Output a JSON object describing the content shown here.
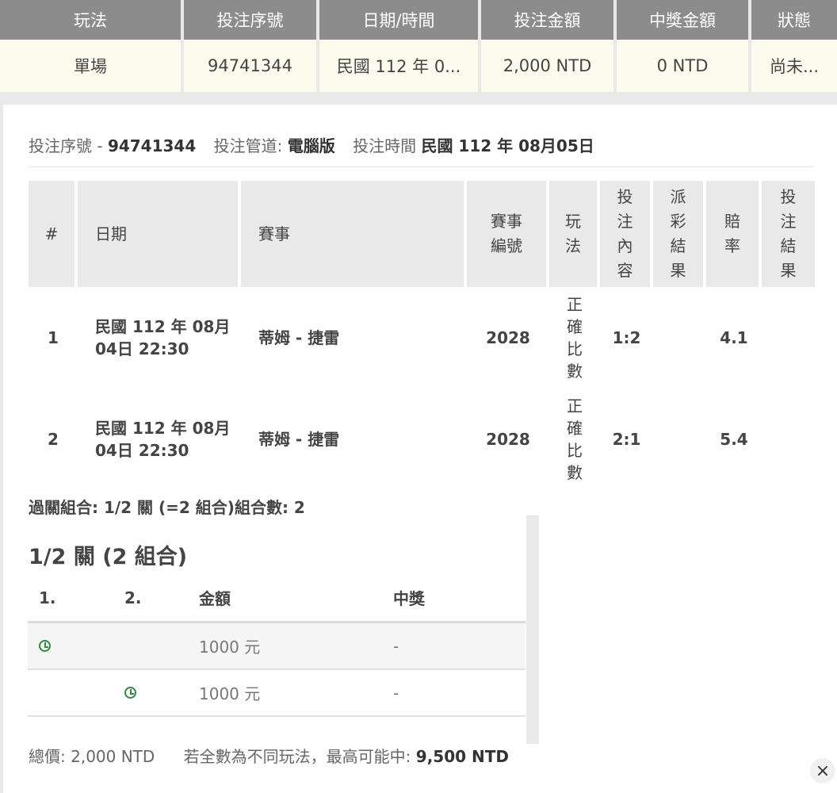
{
  "summary": {
    "headers": [
      "玩法",
      "投注序號",
      "日期/時間",
      "投注金額",
      "中獎金額",
      "狀態"
    ],
    "row": [
      "單場",
      "94741344",
      "民國 112 年 0...",
      "2,000 NTD",
      "0 NTD",
      "尚未..."
    ]
  },
  "info": {
    "serial_label": "投注序號 -",
    "serial": "94741344",
    "channel_label": "投注管道:",
    "channel": "電腦版",
    "time_label": "投注時間",
    "time": "民國 112 年 08月05日"
  },
  "detail": {
    "headers": {
      "idx": "#",
      "date": "日期",
      "match": "賽事",
      "match_no": [
        "賽事",
        "編號"
      ],
      "play": [
        "玩",
        "法"
      ],
      "bet": [
        "投",
        "注",
        "內",
        "容"
      ],
      "result": [
        "派",
        "彩",
        "結",
        "果"
      ],
      "odds": [
        "賠",
        "率"
      ],
      "outcome": [
        "投",
        "注",
        "結",
        "果"
      ]
    },
    "rows": [
      {
        "idx": "1",
        "date": [
          "民國 112 年 08月",
          "04日 22:30"
        ],
        "match": "蒂姆 - 捷雷",
        "match_no": "2028",
        "play": [
          "正",
          "確",
          "比",
          "數"
        ],
        "bet": "1:2",
        "result": "",
        "odds": "4.1",
        "outcome": ""
      },
      {
        "idx": "2",
        "date": [
          "民國 112 年 08月",
          "04日 22:30"
        ],
        "match": "蒂姆 - 捷雷",
        "match_no": "2028",
        "play": [
          "正",
          "確",
          "比",
          "數"
        ],
        "bet": "2:1",
        "result": "",
        "odds": "5.4",
        "outcome": ""
      }
    ]
  },
  "combo": {
    "summary": "過關組合: 1/2 關 (=2 組合)組合數: 2",
    "title": "1/2 關 (2 組合)",
    "headers": [
      "1.",
      "2.",
      "金額",
      "中獎"
    ],
    "rows": [
      {
        "amount": "1000 元",
        "win": "-"
      },
      {
        "amount": "1000 元",
        "win": "-"
      }
    ]
  },
  "total": {
    "label": "總價:",
    "value": "2,000 NTD",
    "max_label": "若全數為不同玩法，最高可能中:",
    "max_value": "9,500 NTD"
  },
  "close_icon": "×",
  "colors": {
    "header_bg": "#8c8c8c",
    "row_bg": "#fcfcee",
    "clock": "#2e8b3e"
  }
}
